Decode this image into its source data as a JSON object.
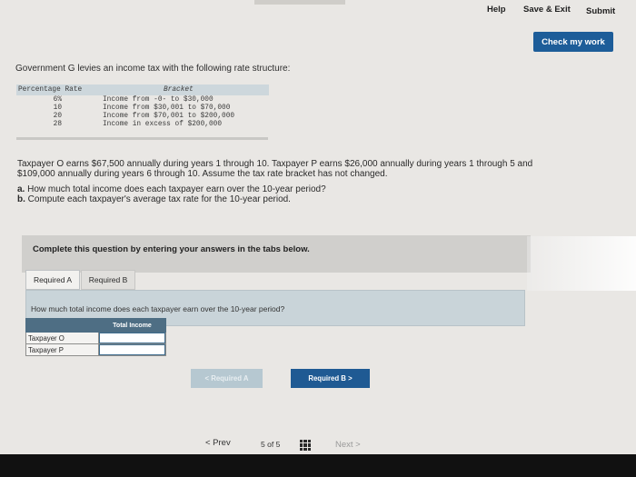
{
  "header": {
    "help": "Help",
    "save_exit": "Save & Exit",
    "submit": "Submit",
    "check_my_work": "Check my work"
  },
  "intro": "Government G levies an income tax with the following rate structure:",
  "rate_table": {
    "col_rate": "Percentage Rate",
    "col_bracket": "Bracket",
    "rows": [
      {
        "rate": "6%",
        "bracket": "Income from -0- to $30,000"
      },
      {
        "rate": "10",
        "bracket": "Income from $30,001 to $70,000"
      },
      {
        "rate": "20",
        "bracket": "Income from $70,001 to $200,000"
      },
      {
        "rate": "28",
        "bracket": "Income in excess of $200,000"
      }
    ]
  },
  "scenario": "Taxpayer O earns $67,500 annually during years 1 through 10. Taxpayer P earns $26,000 annually during years 1 through 5 and $109,000 annually during years 6 through 10. Assume the tax rate bracket has not changed.",
  "questions": {
    "a_label": "a.",
    "a_text": "How much total income does each taxpayer earn over the 10-year period?",
    "b_label": "b.",
    "b_text": "Compute each taxpayer's average tax rate for the 10-year period."
  },
  "banner": "Complete this question by entering your answers in the tabs below.",
  "tabs": {
    "required_a": "Required A",
    "required_b": "Required B"
  },
  "tab_question": "How much total income does each taxpayer earn over the 10-year period?",
  "answer_table": {
    "column": "Total Income",
    "rows": [
      {
        "label": "Taxpayer O",
        "value": ""
      },
      {
        "label": "Taxpayer P",
        "value": ""
      }
    ]
  },
  "nav": {
    "prev_tab": "< Required A",
    "next_tab": "Required B  >"
  },
  "pager": {
    "prev": "< Prev",
    "current": "5",
    "of": "of",
    "total": "5",
    "next": "Next >"
  }
}
